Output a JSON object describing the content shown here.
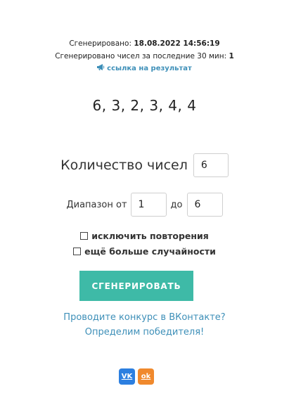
{
  "meta": {
    "generated_label": "Сгенерировано:",
    "generated_value": "18.08.2022 14:56:19",
    "count_label": "Сгенерировано чисел за последние 30 мин:",
    "count_value": "1",
    "result_link": "ссылка на результат"
  },
  "result": {
    "numbers": "6, 3, 2, 3, 4, 4"
  },
  "form": {
    "count_label": "Количество чисел",
    "count_value": "6",
    "range_label": "Диапазон от",
    "range_from": "1",
    "range_to_label": "до",
    "range_to": "6",
    "exclude_repeats_label": "исключить повторения",
    "more_random_label": "ещё больше случайности",
    "generate_button": "СГЕНЕРИРОВАТЬ"
  },
  "promo": {
    "line1": "Проводите конкурс в ВКонтакте?",
    "line2": "Определим победителя!"
  },
  "social": {
    "vk_text": "VK",
    "ok_text": "ok",
    "vk_color": "#2c7fe0",
    "ok_color": "#f0892d"
  },
  "colors": {
    "accent": "#3ebaa7",
    "link": "#3d8fb8"
  }
}
